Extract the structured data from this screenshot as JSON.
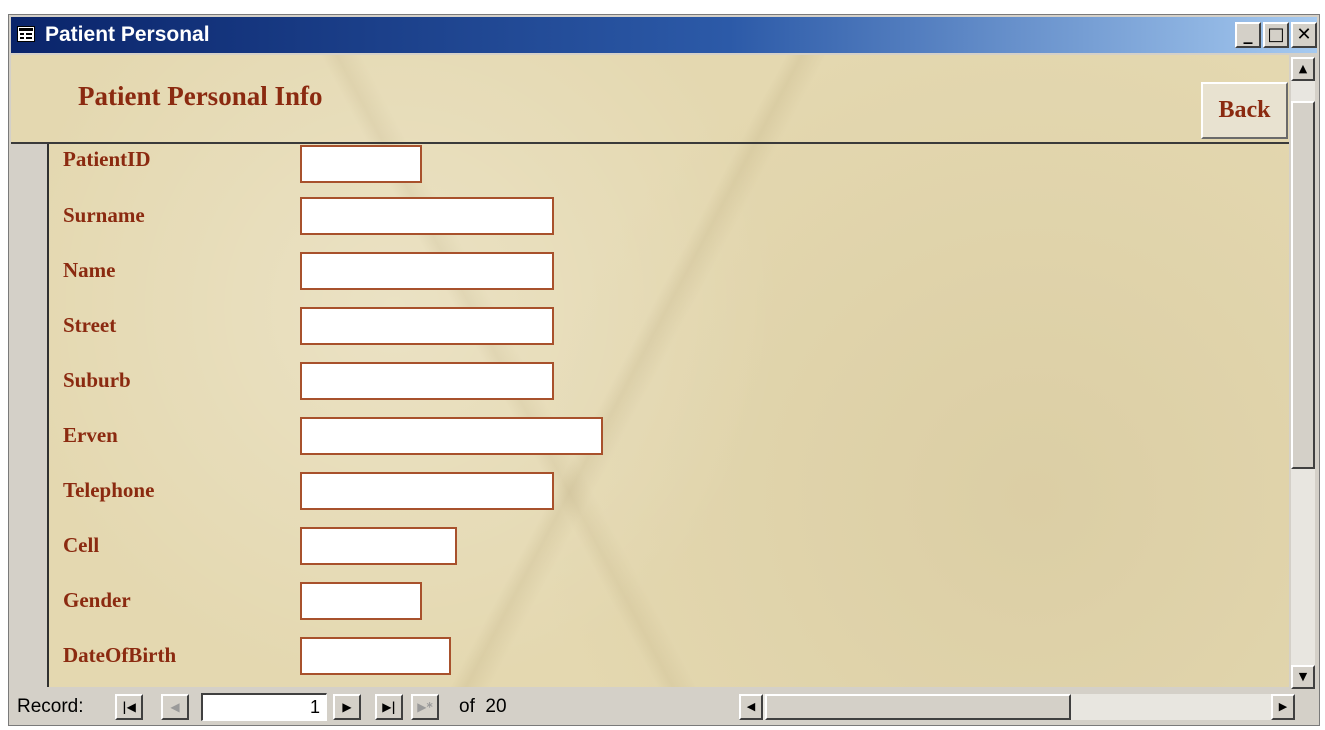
{
  "window": {
    "title": "Patient Personal",
    "minimize_glyph": "_",
    "maximize_glyph": "□",
    "close_glyph": "✕"
  },
  "form": {
    "title": "Patient Personal Info",
    "back_label": "Back",
    "fields": [
      {
        "label": "PatientID",
        "value": ""
      },
      {
        "label": "Surname",
        "value": ""
      },
      {
        "label": "Name",
        "value": ""
      },
      {
        "label": "Street",
        "value": ""
      },
      {
        "label": "Suburb",
        "value": ""
      },
      {
        "label": "Erven",
        "value": ""
      },
      {
        "label": "Telephone",
        "value": ""
      },
      {
        "label": "Cell",
        "value": ""
      },
      {
        "label": "Gender",
        "value": ""
      },
      {
        "label": "DateOfBirth",
        "value": ""
      }
    ]
  },
  "navigation": {
    "record_label": "Record:",
    "current_record": "1",
    "of_label": "of",
    "total_records": "20",
    "first_glyph": "|◀",
    "prev_glyph": "◀",
    "next_glyph": "▶",
    "last_glyph": "▶|",
    "new_glyph": "▶*"
  },
  "icons": {
    "window_icon": "form-icon",
    "scroll_up": "up-arrow-icon",
    "scroll_down": "down-arrow-icon",
    "scroll_left": "left-arrow-icon",
    "scroll_right": "right-arrow-icon"
  },
  "colors": {
    "titlebar_start": "#0a246a",
    "titlebar_end": "#a6caf0",
    "label_text": "#8b2a10",
    "form_background": "#e4d8b0",
    "input_border": "#a8512c"
  }
}
